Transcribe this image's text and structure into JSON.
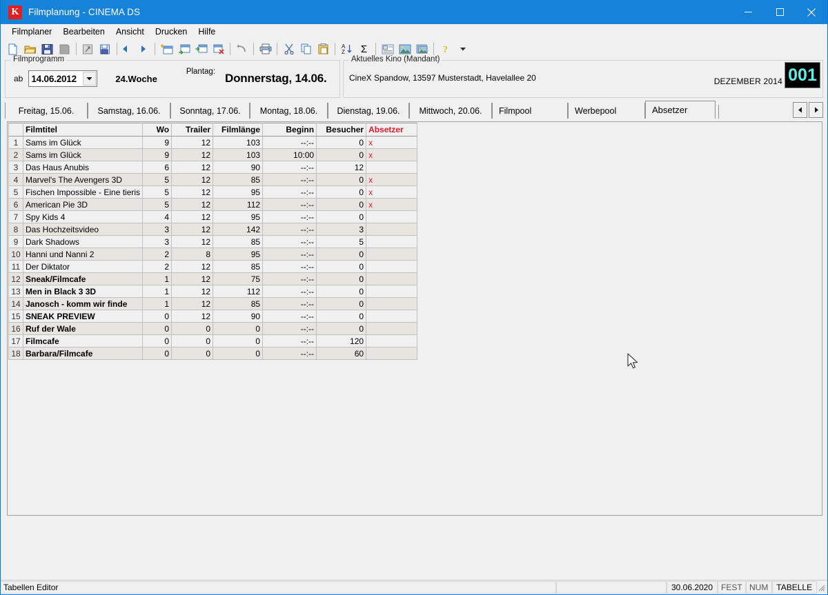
{
  "window": {
    "title": "Filmplanung - CINEMA DS",
    "icon": "K",
    "icon_name": "app-icon-k",
    "minimize": "minimize-icon",
    "maximize": "maximize-icon",
    "close": "close-icon"
  },
  "menubar": {
    "items": [
      {
        "label": "Filmplaner"
      },
      {
        "label": "Bearbeiten"
      },
      {
        "label": "Ansicht"
      },
      {
        "label": "Drucken"
      },
      {
        "label": "Hilfe"
      }
    ]
  },
  "toolbar": {
    "buttons": [
      {
        "name": "new-document-icon"
      },
      {
        "name": "open-folder-icon"
      },
      {
        "name": "save-disk-icon"
      },
      {
        "name": "save-all-icon"
      },
      {
        "sep": true
      },
      {
        "name": "import-icon"
      },
      {
        "name": "export-icon"
      },
      {
        "sep": true
      },
      {
        "name": "previous-arrow-icon"
      },
      {
        "name": "next-arrow-icon"
      },
      {
        "sep": true
      },
      {
        "name": "new-row-icon"
      },
      {
        "name": "insert-row-below-icon"
      },
      {
        "name": "insert-row-icon"
      },
      {
        "name": "delete-row-icon"
      },
      {
        "sep": true
      },
      {
        "name": "undo-icon"
      },
      {
        "sep": true
      },
      {
        "name": "print-icon"
      },
      {
        "sep": true
      },
      {
        "name": "cut-scissors-icon"
      },
      {
        "name": "copy-icon"
      },
      {
        "name": "paste-icon"
      },
      {
        "sep": true
      },
      {
        "name": "sort-az-icon"
      },
      {
        "name": "sum-sigma-icon"
      },
      {
        "sep": true
      },
      {
        "name": "text-block-icon"
      },
      {
        "name": "image-icon"
      },
      {
        "name": "image-settings-icon"
      },
      {
        "sep": true
      },
      {
        "name": "help-question-icon"
      },
      {
        "name": "dropdown-caret-icon"
      }
    ]
  },
  "filmprogramm": {
    "legend": "Filmprogramm",
    "ab_label": "ab",
    "date_value": "14.06.2012",
    "dropdown_icon": "chevron-down-icon",
    "week": "24.Woche",
    "plantag_label": "Plantag:",
    "plantag_value": "Donnerstag, 14.06."
  },
  "kino": {
    "legend": "Aktuelles Kino (Mandant)",
    "name": "CineX Spandow, 13597 Musterstadt, Havelallee 20",
    "lcd_label": "DEZEMBER 2014",
    "lcd_value": "001",
    "lcd_color": "#5ef0e8"
  },
  "tabs": {
    "active_index": 7,
    "items": [
      {
        "label": "Freitag, 15.06."
      },
      {
        "label": "Samstag, 16.06."
      },
      {
        "label": "Sonntag, 17.06."
      },
      {
        "label": "Montag, 18.06."
      },
      {
        "label": "Dienstag, 19.06."
      },
      {
        "label": "Mittwoch, 20.06."
      },
      {
        "label": "Filmpool"
      },
      {
        "label": "Werbepool"
      },
      {
        "label": "Absetzer"
      }
    ],
    "nav_prev": "tab-scroll-left-icon",
    "nav_next": "tab-scroll-right-icon"
  },
  "table": {
    "columns": [
      "",
      "Filmtitel",
      "Wo",
      "Trailer",
      "Filmlänge",
      "Beginn",
      "Besucher",
      "Absetzer"
    ],
    "absetzer_color": "#e8192c",
    "rows": [
      {
        "n": "1",
        "title": "Sams im Glück",
        "wo": "9",
        "trailer": "12",
        "len": "103",
        "beginn": "--:--",
        "besucher": "0",
        "absetzer": "x",
        "bold": false
      },
      {
        "n": "2",
        "title": "Sams im Glück",
        "wo": "9",
        "trailer": "12",
        "len": "103",
        "beginn": "10:00",
        "besucher": "0",
        "absetzer": "x",
        "bold": false
      },
      {
        "n": "3",
        "title": "Das Haus Anubis",
        "wo": "6",
        "trailer": "12",
        "len": "90",
        "beginn": "--:--",
        "besucher": "12",
        "absetzer": "",
        "bold": false
      },
      {
        "n": "4",
        "title": "Marvel's The Avengers 3D",
        "wo": "5",
        "trailer": "12",
        "len": "85",
        "beginn": "--:--",
        "besucher": "0",
        "absetzer": "x",
        "bold": false
      },
      {
        "n": "5",
        "title": "Fischen Impossible - Eine tieris",
        "wo": "5",
        "trailer": "12",
        "len": "95",
        "beginn": "--:--",
        "besucher": "0",
        "absetzer": "x",
        "bold": false
      },
      {
        "n": "6",
        "title": "American Pie 3D",
        "wo": "5",
        "trailer": "12",
        "len": "112",
        "beginn": "--:--",
        "besucher": "0",
        "absetzer": "x",
        "bold": false
      },
      {
        "n": "7",
        "title": "Spy Kids 4",
        "wo": "4",
        "trailer": "12",
        "len": "95",
        "beginn": "--:--",
        "besucher": "0",
        "absetzer": "",
        "bold": false
      },
      {
        "n": "8",
        "title": "Das Hochzeitsvideo",
        "wo": "3",
        "trailer": "12",
        "len": "142",
        "beginn": "--:--",
        "besucher": "3",
        "absetzer": "",
        "bold": false
      },
      {
        "n": "9",
        "title": "Dark Shadows",
        "wo": "3",
        "trailer": "12",
        "len": "85",
        "beginn": "--:--",
        "besucher": "5",
        "absetzer": "",
        "bold": false
      },
      {
        "n": "10",
        "title": "Hanni und Nanni 2",
        "wo": "2",
        "trailer": "8",
        "len": "95",
        "beginn": "--:--",
        "besucher": "0",
        "absetzer": "",
        "bold": false
      },
      {
        "n": "11",
        "title": "Der Diktator",
        "wo": "2",
        "trailer": "12",
        "len": "85",
        "beginn": "--:--",
        "besucher": "0",
        "absetzer": "",
        "bold": false
      },
      {
        "n": "12",
        "title": "Sneak/Filmcafe",
        "wo": "1",
        "trailer": "12",
        "len": "75",
        "beginn": "--:--",
        "besucher": "0",
        "absetzer": "",
        "bold": true
      },
      {
        "n": "13",
        "title": "Men in Black 3 3D",
        "wo": "1",
        "trailer": "12",
        "len": "112",
        "beginn": "--:--",
        "besucher": "0",
        "absetzer": "",
        "bold": true
      },
      {
        "n": "14",
        "title": "Janosch - komm wir finde",
        "wo": "1",
        "trailer": "12",
        "len": "85",
        "beginn": "--:--",
        "besucher": "0",
        "absetzer": "",
        "bold": true
      },
      {
        "n": "15",
        "title": "SNEAK PREVIEW",
        "wo": "0",
        "trailer": "12",
        "len": "90",
        "beginn": "--:--",
        "besucher": "0",
        "absetzer": "",
        "bold": true
      },
      {
        "n": "16",
        "title": "Ruf der Wale",
        "wo": "0",
        "trailer": "0",
        "len": "0",
        "beginn": "--:--",
        "besucher": "0",
        "absetzer": "",
        "bold": true
      },
      {
        "n": "17",
        "title": "Filmcafe",
        "wo": "0",
        "trailer": "0",
        "len": "0",
        "beginn": "--:--",
        "besucher": "120",
        "absetzer": "",
        "bold": true
      },
      {
        "n": "18",
        "title": "Barbara/Filmcafe",
        "wo": "0",
        "trailer": "0",
        "len": "0",
        "beginn": "--:--",
        "besucher": "60",
        "absetzer": "",
        "bold": true
      }
    ]
  },
  "statusbar": {
    "message": "Tabellen Editor",
    "blank": "",
    "date": "30.06.2020",
    "fest": "FEST",
    "num": "NUM",
    "tabelle": "TABELLE"
  }
}
